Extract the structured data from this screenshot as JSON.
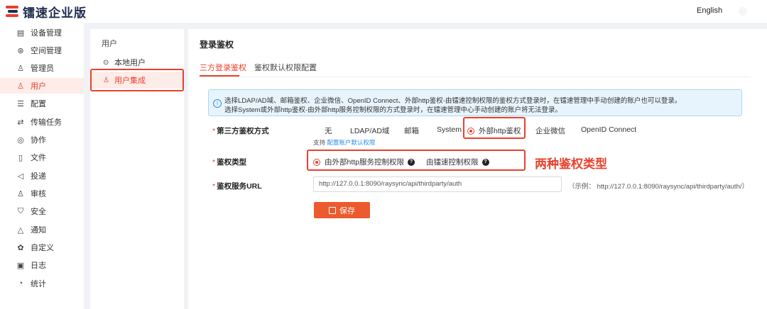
{
  "header": {
    "brand": "镭速企业版",
    "language": "English"
  },
  "sidebar": {
    "items": [
      {
        "label": "设备管理",
        "icon": "device-icon"
      },
      {
        "label": "空间管理",
        "icon": "space-icon"
      },
      {
        "label": "管理员",
        "icon": "admin-icon"
      },
      {
        "label": "用户",
        "icon": "user-icon",
        "active": true
      },
      {
        "label": "配置",
        "icon": "config-icon"
      },
      {
        "label": "传输任务",
        "icon": "transfer-icon"
      },
      {
        "label": "协作",
        "icon": "collab-icon"
      },
      {
        "label": "文件",
        "icon": "file-icon"
      },
      {
        "label": "投递",
        "icon": "send-icon"
      },
      {
        "label": "审核",
        "icon": "review-icon"
      },
      {
        "label": "安全",
        "icon": "shield-icon"
      },
      {
        "label": "通知",
        "icon": "bell-icon"
      },
      {
        "label": "自定义",
        "icon": "custom-icon"
      },
      {
        "label": "日志",
        "icon": "log-icon"
      },
      {
        "label": "统计",
        "icon": "stats-icon"
      }
    ]
  },
  "subnav": {
    "title": "用户",
    "items": [
      {
        "label": "本地用户",
        "icon": "local-user-icon"
      },
      {
        "label": "用户集成",
        "icon": "integration-icon",
        "active": true
      }
    ]
  },
  "main": {
    "title": "登录鉴权",
    "tabs": [
      {
        "label": "三方登录鉴权",
        "active": true
      },
      {
        "label": "鉴权默认权限配置"
      }
    ],
    "alert": {
      "line1": "选择LDAP/AD域、邮箱鉴权、企业微信、OpenID Connect、外部http鉴权-由镭速控制权限的鉴权方式登录时，在镭速管理中手动创建的账户也可以登录。",
      "line2": "选择System或外部http鉴权-由外部http服务控制权限的方式登录时，在镭速管理中心手动创建的账户将无法登录。"
    },
    "auth_method": {
      "label": "第三方鉴权方式",
      "options": [
        "无",
        "LDAP/AD域",
        "邮箱",
        "System",
        "外部http鉴权",
        "企业微信",
        "OpenID Connect"
      ],
      "selected": "外部http鉴权",
      "hint_prefix": "支持",
      "hint_link": "配置账户默认权限"
    },
    "auth_type": {
      "label": "鉴权类型",
      "options": [
        "由外部http服务控制权限",
        "由镭速控制权限"
      ],
      "selected": "由外部http服务控制权限"
    },
    "auth_url": {
      "label": "鉴权服务URL",
      "value": "http://127.0.0.1:8090/raysync/api/thirdparty/auth",
      "example": "（示例：  http://127.0.0.1:8090/raysync/api/thirdparty/auth/）"
    },
    "save_label": "保存"
  },
  "annotation": "两种鉴权类型",
  "colors": {
    "accent": "#e8412c",
    "button": "#ec5b2d",
    "info": "#2a8ee8"
  }
}
